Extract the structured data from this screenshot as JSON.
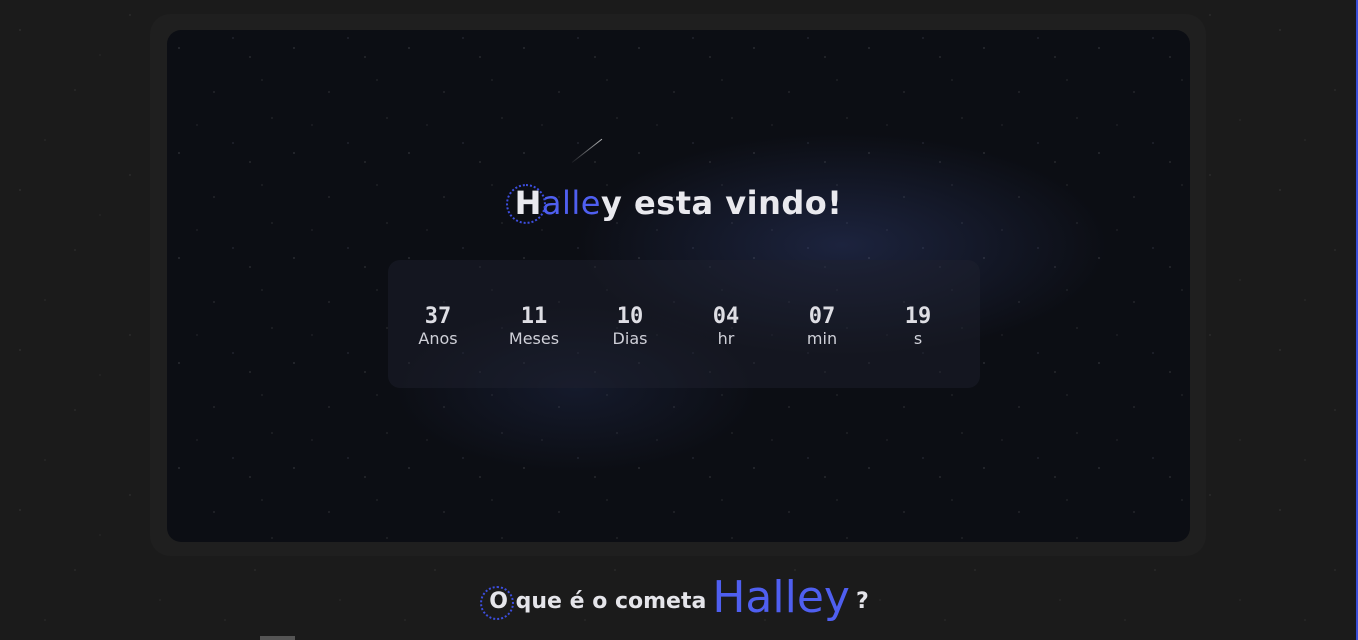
{
  "hero": {
    "title_first": "H",
    "title_accent": "alle",
    "title_rest": "y esta vindo!"
  },
  "countdown": [
    {
      "value": "37",
      "label": "Anos"
    },
    {
      "value": "11",
      "label": "Meses"
    },
    {
      "value": "10",
      "label": "Dias"
    },
    {
      "value": "04",
      "label": "hr"
    },
    {
      "value": "07",
      "label": "min"
    },
    {
      "value": "19",
      "label": "s"
    }
  ],
  "section": {
    "heading_prefix": "O que é o cometa",
    "heading_accent": "Halley",
    "heading_suffix": "?"
  },
  "colors": {
    "accent": "#4f5ff0",
    "background": "#1b1b1b",
    "text": "#e9e9ee"
  }
}
